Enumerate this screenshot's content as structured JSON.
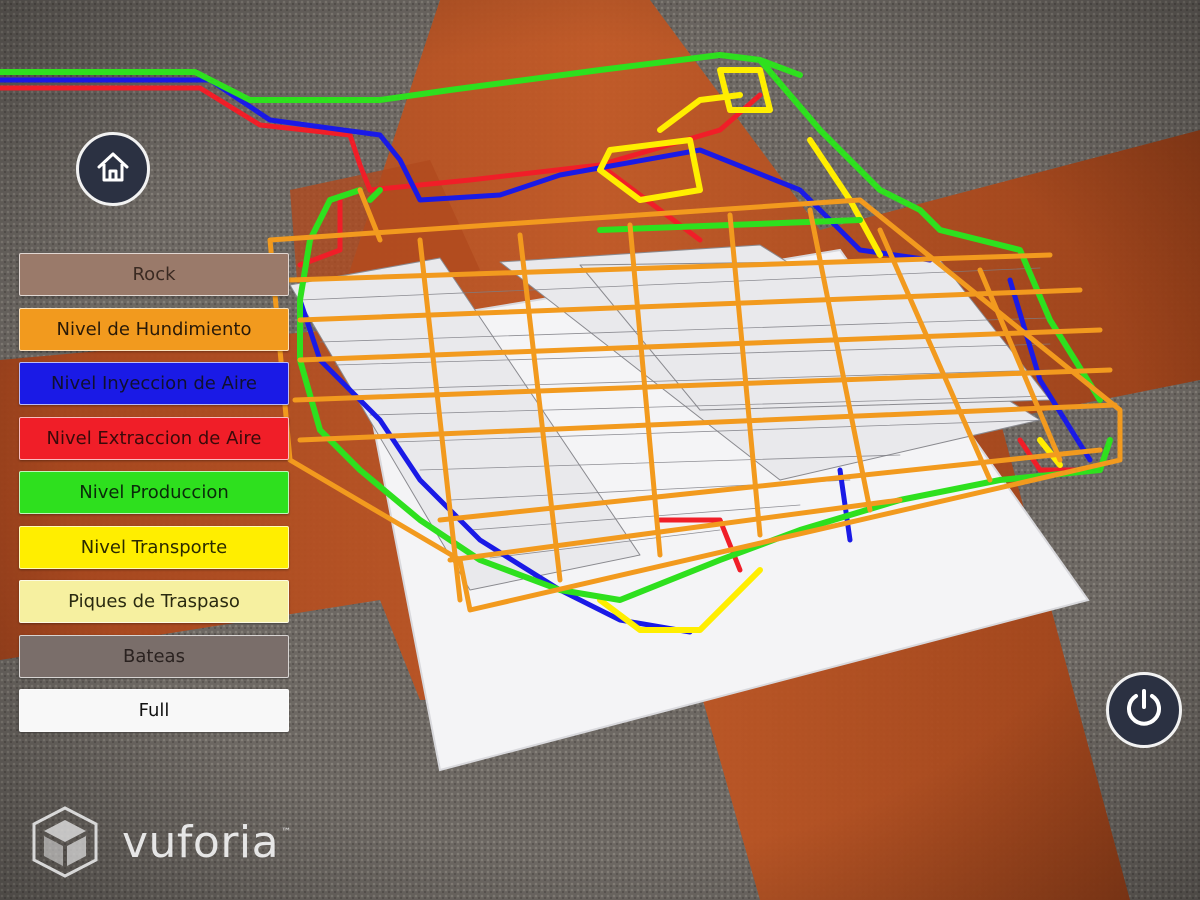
{
  "toolbar": {
    "home_icon": "home-icon",
    "power_icon": "power-icon"
  },
  "layers": [
    {
      "label": "Rock",
      "bg": "#9a7a6a",
      "fg": "#3a2a22"
    },
    {
      "label": "Nivel de Hundimiento",
      "bg": "#f29a1e",
      "fg": "#2a1a08"
    },
    {
      "label": "Nivel Inyeccion de Aire",
      "bg": "#1a1ae6",
      "fg": "#101030"
    },
    {
      "label": "Nivel Extraccion de Aire",
      "bg": "#f01e28",
      "fg": "#3a0a0a"
    },
    {
      "label": "Nivel Produccion",
      "bg": "#2ee01e",
      "fg": "#0a2a0a"
    },
    {
      "label": "Nivel Transporte",
      "bg": "#ffee00",
      "fg": "#2a2a00"
    },
    {
      "label": "Piques de Traspaso",
      "bg": "#f6f0a0",
      "fg": "#2a2a10"
    },
    {
      "label": "Bateas",
      "bg": "#7a6e6a",
      "fg": "#2a2220"
    },
    {
      "label": "Full",
      "bg": "#f8f8f8",
      "fg": "#111111"
    }
  ],
  "brand": {
    "name": "vuforia",
    "tm": "™",
    "logo_icon": "vuforia-cube-icon"
  },
  "colors": {
    "orange": "#f29a1e",
    "blue": "#1a1ae6",
    "red": "#f01e28",
    "green": "#2ee01e",
    "yellow": "#ffee00"
  }
}
